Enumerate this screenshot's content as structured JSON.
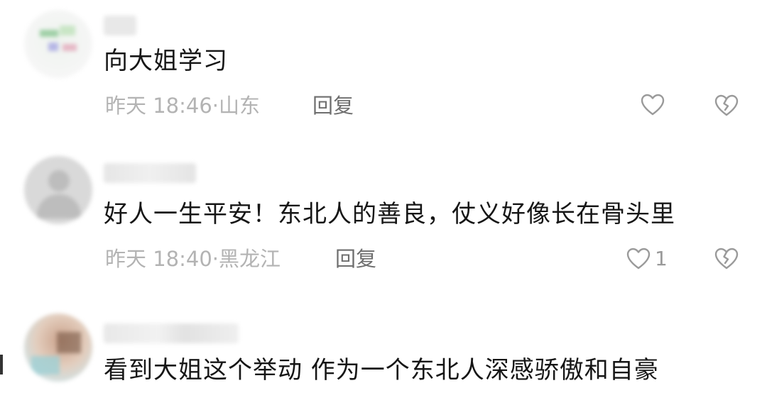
{
  "comments": [
    {
      "text": "向大姐学习",
      "time": "昨天 18:46",
      "location": "山东",
      "reply_label": "回复",
      "like_count": ""
    },
    {
      "text": "好人一生平安！东北人的善良，仗义好像长在骨头里",
      "time": "昨天 18:40",
      "location": "黑龙江",
      "reply_label": "回复",
      "like_count": "1"
    },
    {
      "text": "看到大姐这个举动 作为一个东北人深感骄傲和自豪"
    }
  ],
  "separator": "·",
  "icons": {
    "like": "heart-outline-icon",
    "dislike": "broken-heart-icon"
  },
  "colors": {
    "text": "#161616",
    "meta": "#b3b3b3",
    "reply": "#6e6e6e",
    "icon": "#9a9a9a"
  }
}
